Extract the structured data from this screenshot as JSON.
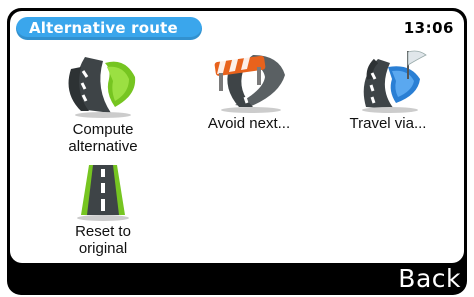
{
  "header": {
    "title": "Alternative route",
    "clock": "13:06"
  },
  "options": [
    {
      "label": "Compute\nalternative",
      "icon": "compute-alternative-road-icon"
    },
    {
      "label": "Avoid next...",
      "icon": "road-block-icon"
    },
    {
      "label": "Travel via...",
      "icon": "travel-via-flag-icon"
    },
    {
      "label": "Reset to\noriginal",
      "icon": "straight-road-icon"
    }
  ],
  "footer": {
    "back_label": "Back"
  },
  "colors": {
    "accent": "#3aa6ec",
    "road": "#4a5053",
    "green": "#76c521",
    "blue": "#2a7fd4",
    "orange": "#e8621c"
  }
}
